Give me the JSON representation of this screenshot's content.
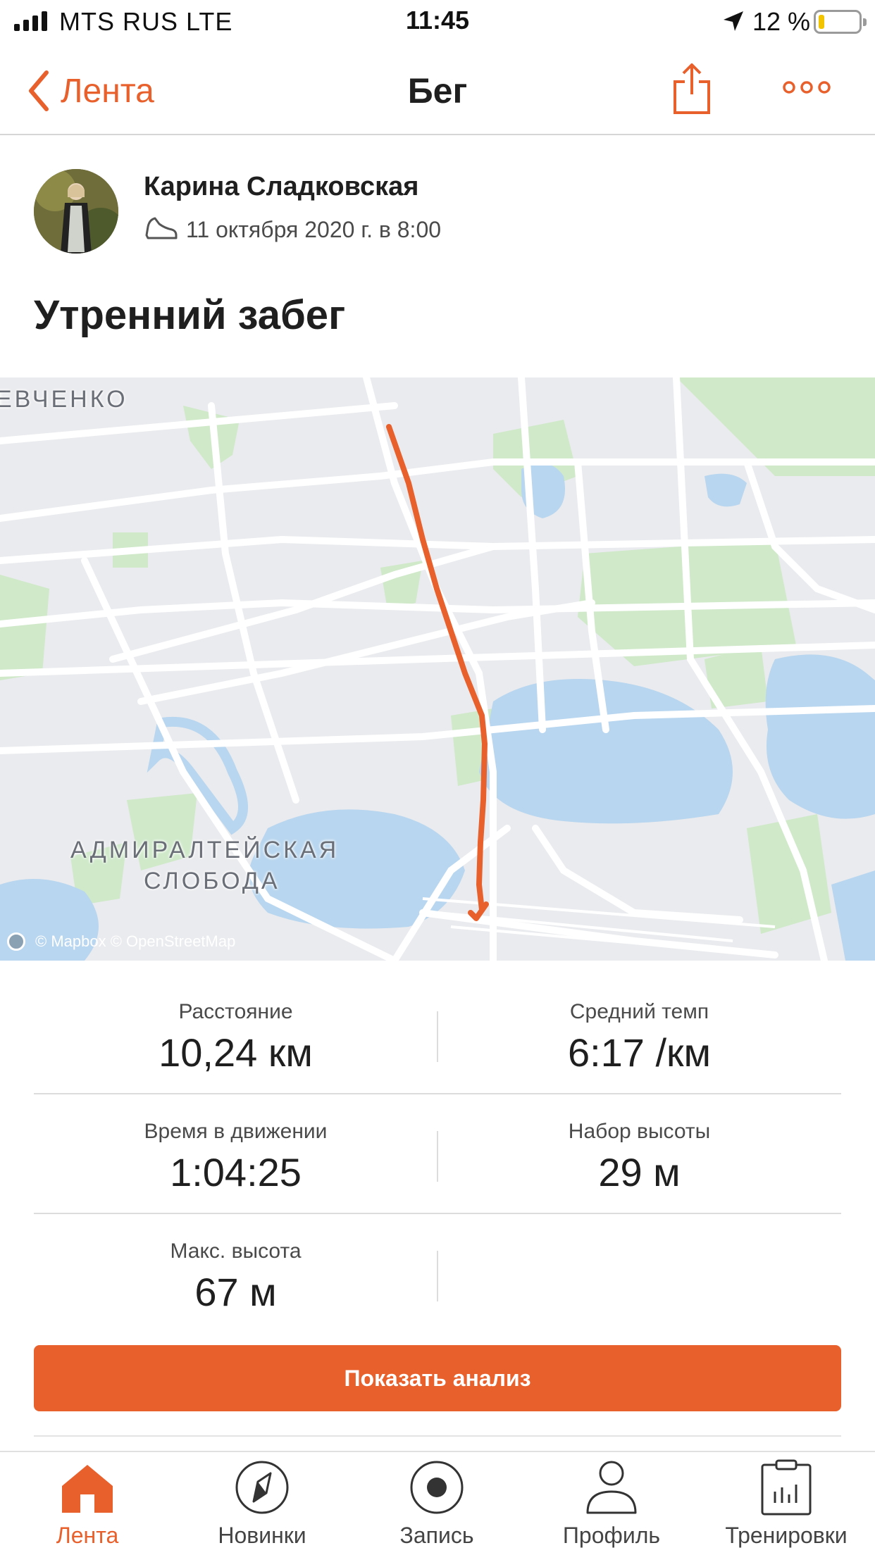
{
  "status_bar": {
    "carrier": "MTS RUS   LTE",
    "time": "11:45",
    "battery": "12 %"
  },
  "nav": {
    "back_label": "Лента",
    "title": "Бег"
  },
  "activity": {
    "athlete_name": "Карина Сладковская",
    "date": "11 октября 2020 г. в 8:00",
    "title": "Утренний забег"
  },
  "map": {
    "labels": [
      "ЕВЧЕНКО",
      "АДМИРАЛТЕЙСКАЯ",
      "СЛОБОДА"
    ],
    "attribution": "© Mapbox © OpenStreetMap",
    "route_color": "#e8602c"
  },
  "stats": [
    {
      "label": "Расстояние",
      "value": "10,24 км"
    },
    {
      "label": "Средний темп",
      "value": "6:17 /км"
    },
    {
      "label": "Время в движении",
      "value": "1:04:25"
    },
    {
      "label": "Набор высоты",
      "value": "29 м"
    },
    {
      "label": "Макс. высота",
      "value": "67 м"
    }
  ],
  "analysis_button": "Показать анализ",
  "tabs": [
    {
      "label": "Лента",
      "icon": "home-icon",
      "active": true
    },
    {
      "label": "Новинки",
      "icon": "compass-icon",
      "active": false
    },
    {
      "label": "Запись",
      "icon": "record-icon",
      "active": false
    },
    {
      "label": "Профиль",
      "icon": "profile-icon",
      "active": false
    },
    {
      "label": "Тренировки",
      "icon": "training-clipboard-icon",
      "active": false
    }
  ],
  "colors": {
    "accent": "#e8602c",
    "water": "#b8d6ef",
    "park": "#cfe9c9",
    "road": "#ffffff",
    "map_base": "#eaebee"
  }
}
